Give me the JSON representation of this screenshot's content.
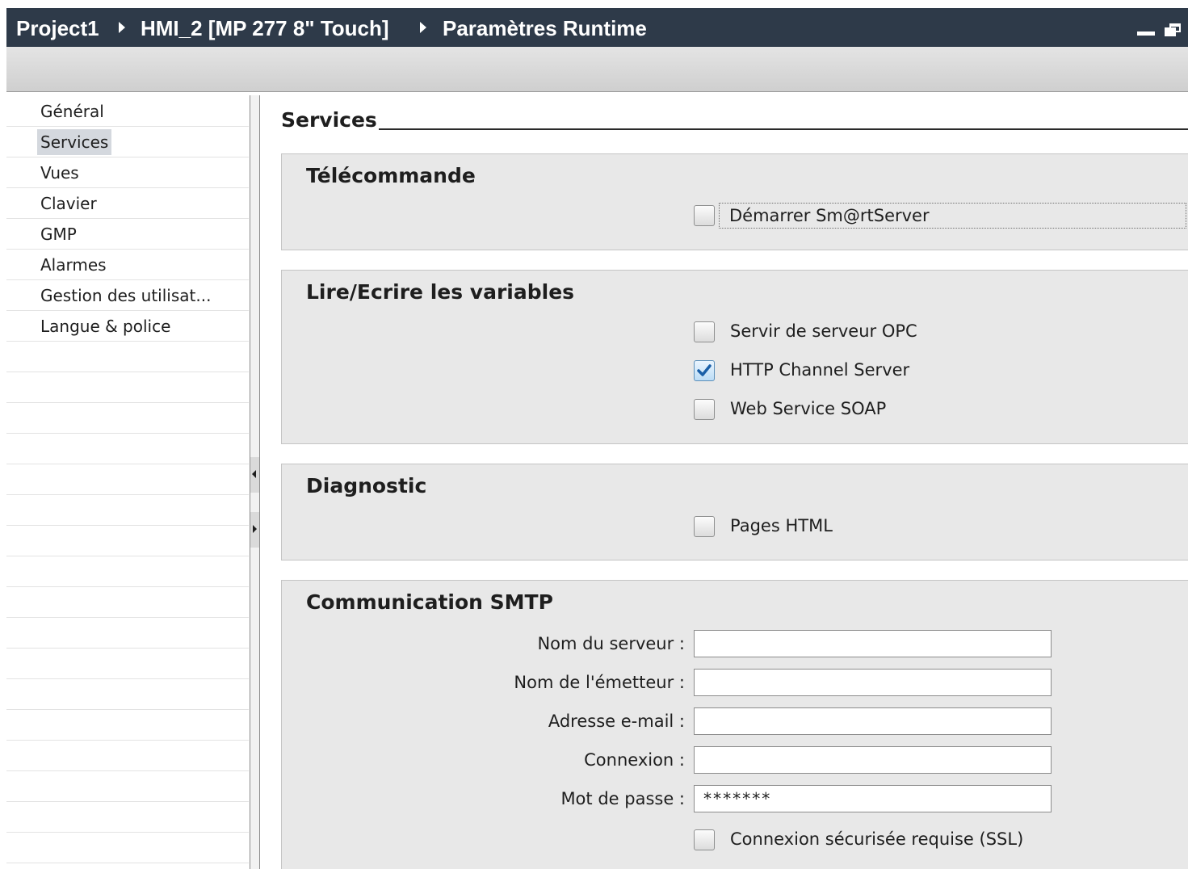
{
  "titlebar": {
    "crumbs": [
      "Project1",
      "HMI_2 [MP 277 8\" Touch]",
      "Paramètres Runtime"
    ]
  },
  "nav": {
    "items": [
      "Général",
      "Services",
      "Vues",
      "Clavier",
      "GMP",
      "Alarmes",
      "Gestion des utilisat...",
      "Langue & police"
    ],
    "selected": "Services"
  },
  "content": {
    "section_title": "Services",
    "groups": {
      "telecommande": {
        "title": "Télécommande",
        "options": [
          {
            "label": "Démarrer Sm@rtServer",
            "checked": false
          }
        ]
      },
      "variables": {
        "title": "Lire/Ecrire les variables",
        "options": [
          {
            "label": "Servir de serveur OPC",
            "checked": false
          },
          {
            "label": "HTTP Channel Server",
            "checked": true
          },
          {
            "label": "Web Service SOAP",
            "checked": false
          }
        ]
      },
      "diagnostic": {
        "title": "Diagnostic",
        "options": [
          {
            "label": "Pages HTML",
            "checked": false
          }
        ]
      },
      "smtp": {
        "title": "Communication SMTP",
        "fields": [
          {
            "label": "Nom du serveur :",
            "value": ""
          },
          {
            "label": "Nom de l'émetteur :",
            "value": ""
          },
          {
            "label": "Adresse e-mail :",
            "value": ""
          },
          {
            "label": "Connexion :",
            "value": ""
          },
          {
            "label": "Mot de passe :",
            "value": "*******"
          }
        ],
        "options": [
          {
            "label": "Connexion sécurisée requise (SSL)",
            "checked": false
          }
        ]
      }
    }
  },
  "colors": {
    "titlebar_bg": "#2e3a49",
    "group_bg": "#e8e8e8",
    "nav_selected_bg": "#d4d8de",
    "check_accent": "#1a5fa8"
  },
  "icons": [
    "breadcrumb-arrow-icon",
    "minimize-icon",
    "restore-icon",
    "collapse-left-icon",
    "expand-right-icon",
    "checkmark-icon"
  ]
}
